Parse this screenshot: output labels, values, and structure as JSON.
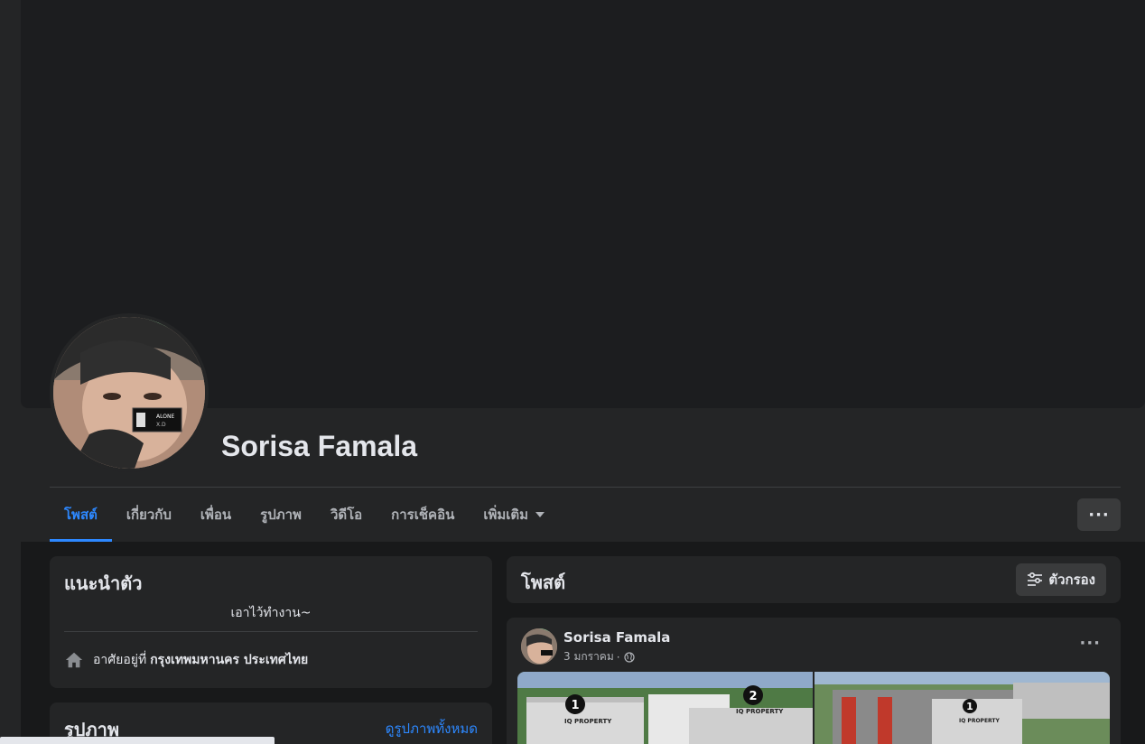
{
  "profile": {
    "name": "Sorisa Famala",
    "avatar_badge_line1": "ALONE",
    "avatar_badge_line2": "X.D"
  },
  "tabs": [
    {
      "label": "โพสต์",
      "active": true
    },
    {
      "label": "เกี่ยวกับ",
      "active": false
    },
    {
      "label": "เพื่อน",
      "active": false
    },
    {
      "label": "รูปภาพ",
      "active": false
    },
    {
      "label": "วิดีโอ",
      "active": false
    },
    {
      "label": "การเช็คอิน",
      "active": false
    },
    {
      "label": "เพิ่มเติม",
      "active": false
    }
  ],
  "more_button": "···",
  "intro": {
    "title": "แนะนำตัว",
    "bio": "เอาไว้ทำงาน~",
    "lives_in_prefix": "อาศัยอยู่ที่",
    "lives_in_place": "กรุงเทพมหานคร ประเทศไทย",
    "icon": "home-icon"
  },
  "photos": {
    "title": "รูปภาพ",
    "see_all": "ดูรูปภาพทั้งหมด"
  },
  "posts": {
    "title": "โพสต์",
    "filter_label": "ตัวกรอง",
    "items": [
      {
        "author": "Sorisa Famala",
        "date": "3 มกราคม",
        "separator": "·",
        "more": "···",
        "image_labels": [
          "1",
          "IQ PROPERTY",
          "2",
          "IQ PROPERTY",
          "1",
          "IQ PROPERTY"
        ]
      }
    ]
  },
  "colors": {
    "accent": "#2d88ff",
    "background": "#18191a",
    "card": "#242526",
    "button": "#3a3b3c"
  }
}
